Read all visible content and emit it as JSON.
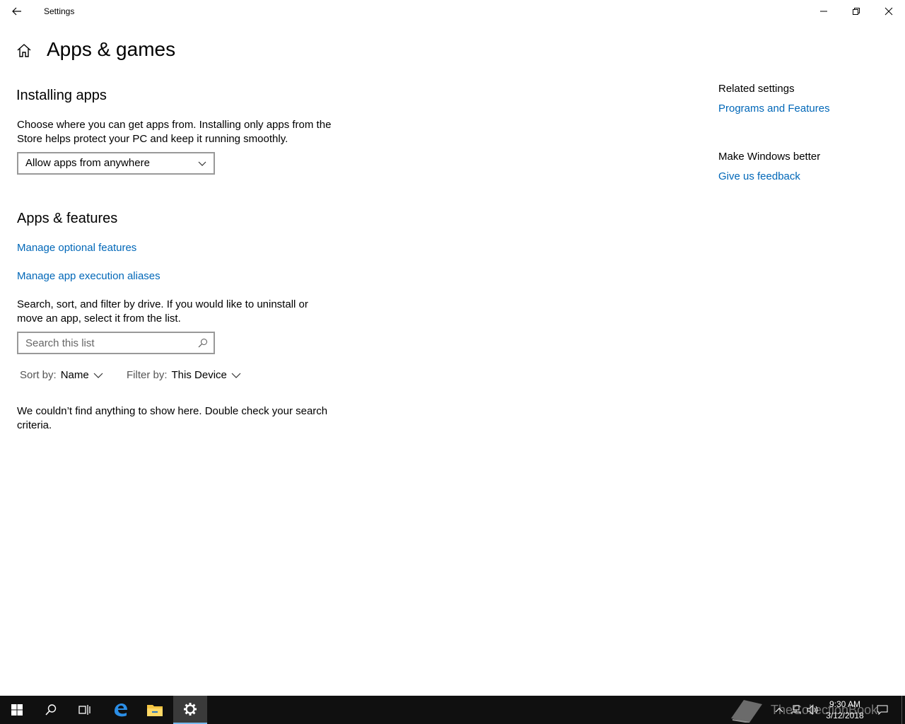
{
  "window": {
    "title": "Settings"
  },
  "page": {
    "title": "Apps & games"
  },
  "installing": {
    "heading": "Installing apps",
    "description": "Choose where you can get apps from. Installing only apps from the Store helps protect your PC and keep it running smoothly.",
    "dropdown_value": "Allow apps from anywhere"
  },
  "apps_features": {
    "heading": "Apps & features",
    "link_optional": "Manage optional features",
    "link_aliases": "Manage app execution aliases",
    "description": "Search, sort, and filter by drive. If you would like to uninstall or move an app, select it from the list.",
    "search_placeholder": "Search this list",
    "sort_label": "Sort by:",
    "sort_value": "Name",
    "filter_label": "Filter by:",
    "filter_value": "This Device",
    "empty_message": "We couldn’t find anything to show here. Double check your search criteria."
  },
  "related": {
    "heading": "Related settings",
    "link": "Programs and Features"
  },
  "feedback": {
    "heading": "Make Windows better",
    "link": "Give us feedback"
  },
  "taskbar": {
    "time": "9:30 AM",
    "date": "3/12/2018",
    "watermark": "TheCollectionBook"
  },
  "colors": {
    "link": "#0067b8",
    "taskbar": "#101010",
    "active_indicator": "#76b9ed"
  }
}
